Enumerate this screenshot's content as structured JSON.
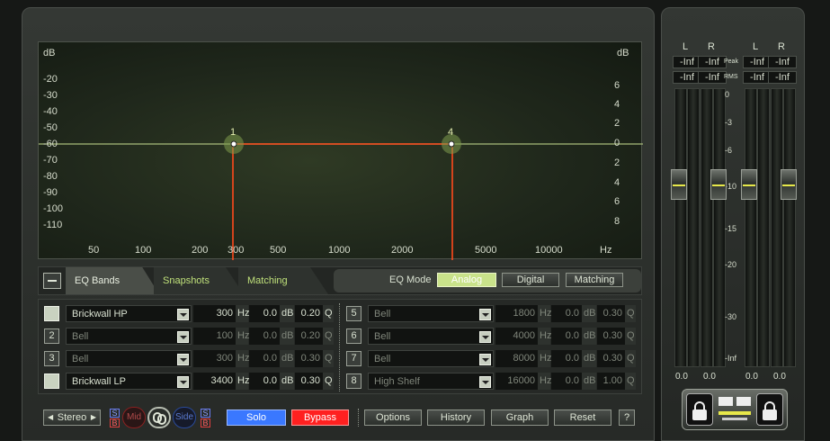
{
  "graph": {
    "unit_left": "dB",
    "unit_right": "dB",
    "left_ticks": [
      "-20",
      "-30",
      "-40",
      "-50",
      "-60",
      "-70",
      "-80",
      "-90",
      "-100",
      "-110"
    ],
    "right_ticks": [
      "6",
      "4",
      "2",
      "0",
      "2",
      "4",
      "6",
      "8"
    ],
    "freq_ticks": [
      "50",
      "100",
      "200",
      "300",
      "500",
      "1000",
      "2000",
      "5000",
      "10000",
      "Hz"
    ],
    "nodes": [
      "1",
      "4"
    ]
  },
  "tabs": {
    "toggle_icon": "minus-icon",
    "eq_bands": "EQ Bands",
    "snapshots": "Snapshots",
    "matching": "Matching",
    "eq_mode_label": "EQ Mode",
    "modes": [
      "Analog",
      "Digital",
      "Matching"
    ],
    "selected_mode": "Analog"
  },
  "bands_left": [
    {
      "num": "1",
      "type": "Brickwall HP",
      "freq": "300",
      "freq_unit": "Hz",
      "gain": "0.0",
      "gain_unit": "dB",
      "q": "0.20",
      "q_unit": "Q",
      "active": true
    },
    {
      "num": "2",
      "type": "Bell",
      "freq": "100",
      "freq_unit": "Hz",
      "gain": "0.0",
      "gain_unit": "dB",
      "q": "0.20",
      "q_unit": "Q",
      "active": false
    },
    {
      "num": "3",
      "type": "Bell",
      "freq": "300",
      "freq_unit": "Hz",
      "gain": "0.0",
      "gain_unit": "dB",
      "q": "0.30",
      "q_unit": "Q",
      "active": false
    },
    {
      "num": "4",
      "type": "Brickwall LP",
      "freq": "3400",
      "freq_unit": "Hz",
      "gain": "0.0",
      "gain_unit": "dB",
      "q": "0.30",
      "q_unit": "Q",
      "active": true
    }
  ],
  "bands_right": [
    {
      "num": "5",
      "type": "Bell",
      "freq": "1800",
      "freq_unit": "Hz",
      "gain": "0.0",
      "gain_unit": "dB",
      "q": "0.30",
      "q_unit": "Q",
      "active": false
    },
    {
      "num": "6",
      "type": "Bell",
      "freq": "4000",
      "freq_unit": "Hz",
      "gain": "0.0",
      "gain_unit": "dB",
      "q": "0.30",
      "q_unit": "Q",
      "active": false
    },
    {
      "num": "7",
      "type": "Bell",
      "freq": "8000",
      "freq_unit": "Hz",
      "gain": "0.0",
      "gain_unit": "dB",
      "q": "0.30",
      "q_unit": "Q",
      "active": false
    },
    {
      "num": "8",
      "type": "High Shelf",
      "freq": "16000",
      "freq_unit": "Hz",
      "gain": "0.0",
      "gain_unit": "dB",
      "q": "1.00",
      "q_unit": "Q",
      "active": false
    }
  ],
  "bottom": {
    "stereo": "Stereo",
    "s_label": "S",
    "b_label": "B",
    "mid": "Mid",
    "side": "Side",
    "solo": "Solo",
    "bypass": "Bypass",
    "options": "Options",
    "history": "History",
    "graph": "Graph",
    "reset": "Reset",
    "help": "?"
  },
  "meters": {
    "channels": [
      "L",
      "R",
      "L",
      "R"
    ],
    "peak_label": "Peak",
    "rms_label": "RMS",
    "peak_values": [
      "-Inf",
      "-Inf",
      "-Inf",
      "-Inf"
    ],
    "rms_values": [
      "-Inf",
      "-Inf",
      "-Inf",
      "-Inf"
    ],
    "scale": [
      "0",
      "-3",
      "-6",
      "-10",
      "-15",
      "-20",
      "-30",
      "-Inf"
    ],
    "readouts": [
      "0.0",
      "0.0",
      "0.0",
      "0.0"
    ],
    "lock_icon": "lock-icon",
    "link_icon": "link-icon"
  },
  "colors": {
    "curve": "#ff4a1c",
    "solo": "#3a78ff",
    "bypass": "#ff2020",
    "accent": "#bfe07a"
  }
}
